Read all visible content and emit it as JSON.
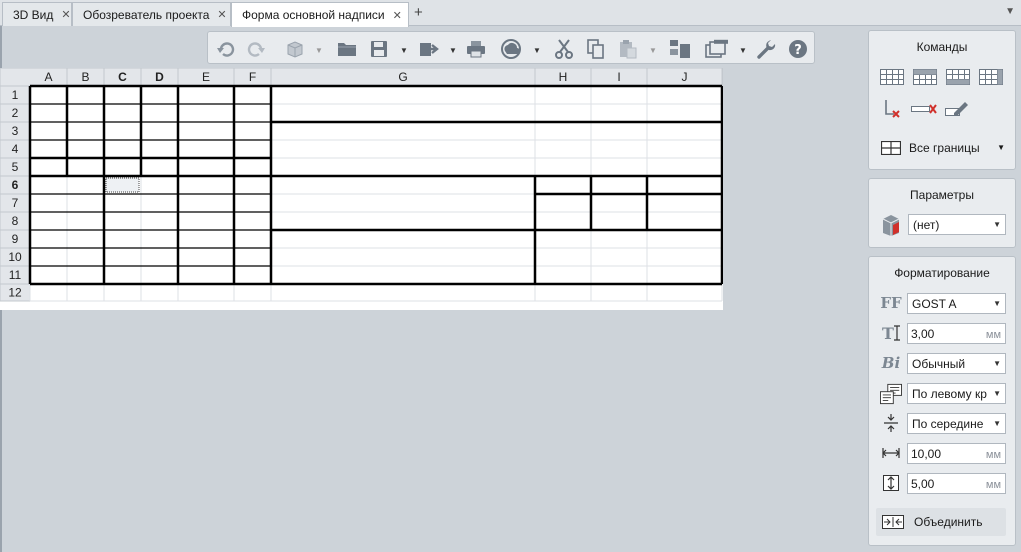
{
  "tabs": [
    {
      "label": "3D Вид",
      "close": "✕"
    },
    {
      "label": "Обозреватель проекта",
      "close": "✕"
    },
    {
      "label": "Форма основной надписи",
      "close": "✕"
    }
  ],
  "tab_add": "+",
  "tab_menu": "▼",
  "toolbar": {
    "icons": [
      "undo-icon",
      "redo-icon",
      "3d-box-icon",
      "open-folder-icon",
      "save-icon",
      "export-icon",
      "print-icon",
      "cloud-sync-icon",
      "cut-icon",
      "copy-icon",
      "paste-icon",
      "layers-icon",
      "windows-icon",
      "wrench-icon",
      "help-icon"
    ]
  },
  "spreadsheet": {
    "columns": [
      "A",
      "B",
      "C",
      "D",
      "E",
      "F",
      "G",
      "H",
      "I",
      "J"
    ],
    "rows": [
      "1",
      "2",
      "3",
      "4",
      "5",
      "6",
      "7",
      "8",
      "9",
      "10",
      "11",
      "12"
    ],
    "active_row": "6",
    "active_cell": "C6"
  },
  "commands": {
    "title": "Команды",
    "border_label": "Все границы"
  },
  "parameters": {
    "title": "Параметры",
    "value": "(нет)"
  },
  "formatting": {
    "title": "Форматирование",
    "font": "GOST A",
    "height": "3,00",
    "height_unit": "мм",
    "style": "Обычный",
    "halign": "По левому кр",
    "valign": "По середине",
    "width": "10,00",
    "width_unit": "мм",
    "row_height": "5,00",
    "row_height_unit": "мм",
    "font_icon_text": "FF",
    "height_icon_text": "T",
    "style_icon_text": "Bi",
    "merge_label": "Объединить"
  },
  "colors": {
    "accent": "#2f6fb5",
    "border": "#b9c0c7",
    "panel": "#e9ecef",
    "background": "#cdd3d9"
  }
}
